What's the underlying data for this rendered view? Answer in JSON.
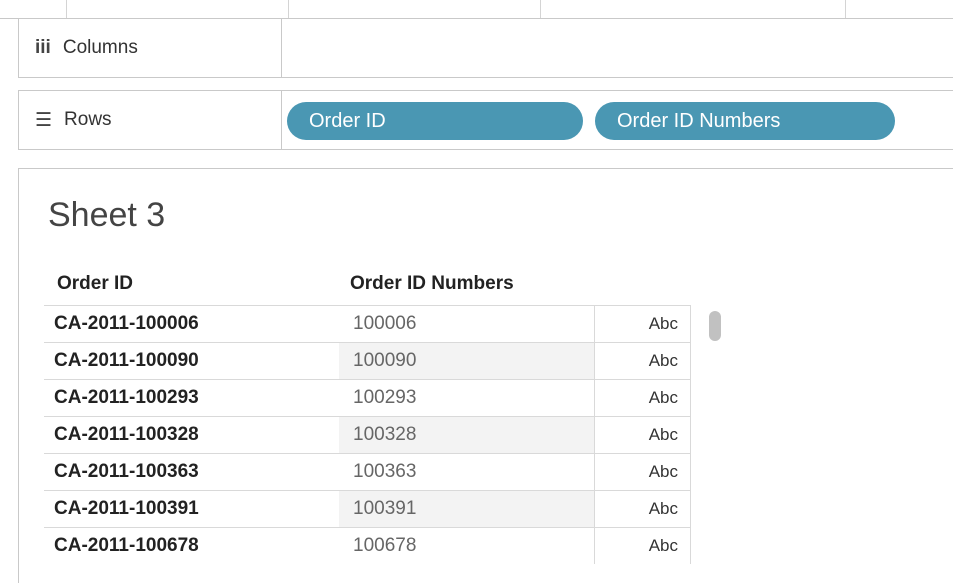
{
  "shelves": {
    "columns": {
      "label": "Columns",
      "icon": "iii"
    },
    "rows": {
      "label": "Rows",
      "icon": "☰",
      "pills": [
        "Order ID",
        "Order ID Numbers"
      ]
    }
  },
  "sheet": {
    "title": "Sheet 3",
    "headers": [
      "Order ID",
      "Order ID Numbers"
    ],
    "rows": [
      {
        "order_id": "CA-2011-100006",
        "number": "100006",
        "type": "Abc"
      },
      {
        "order_id": "CA-2011-100090",
        "number": "100090",
        "type": "Abc"
      },
      {
        "order_id": "CA-2011-100293",
        "number": "100293",
        "type": "Abc"
      },
      {
        "order_id": "CA-2011-100328",
        "number": "100328",
        "type": "Abc"
      },
      {
        "order_id": "CA-2011-100363",
        "number": "100363",
        "type": "Abc"
      },
      {
        "order_id": "CA-2011-100391",
        "number": "100391",
        "type": "Abc"
      },
      {
        "order_id": "CA-2011-100678",
        "number": "100678",
        "type": "Abc"
      }
    ]
  },
  "colors": {
    "pill": "#4a97b3"
  }
}
